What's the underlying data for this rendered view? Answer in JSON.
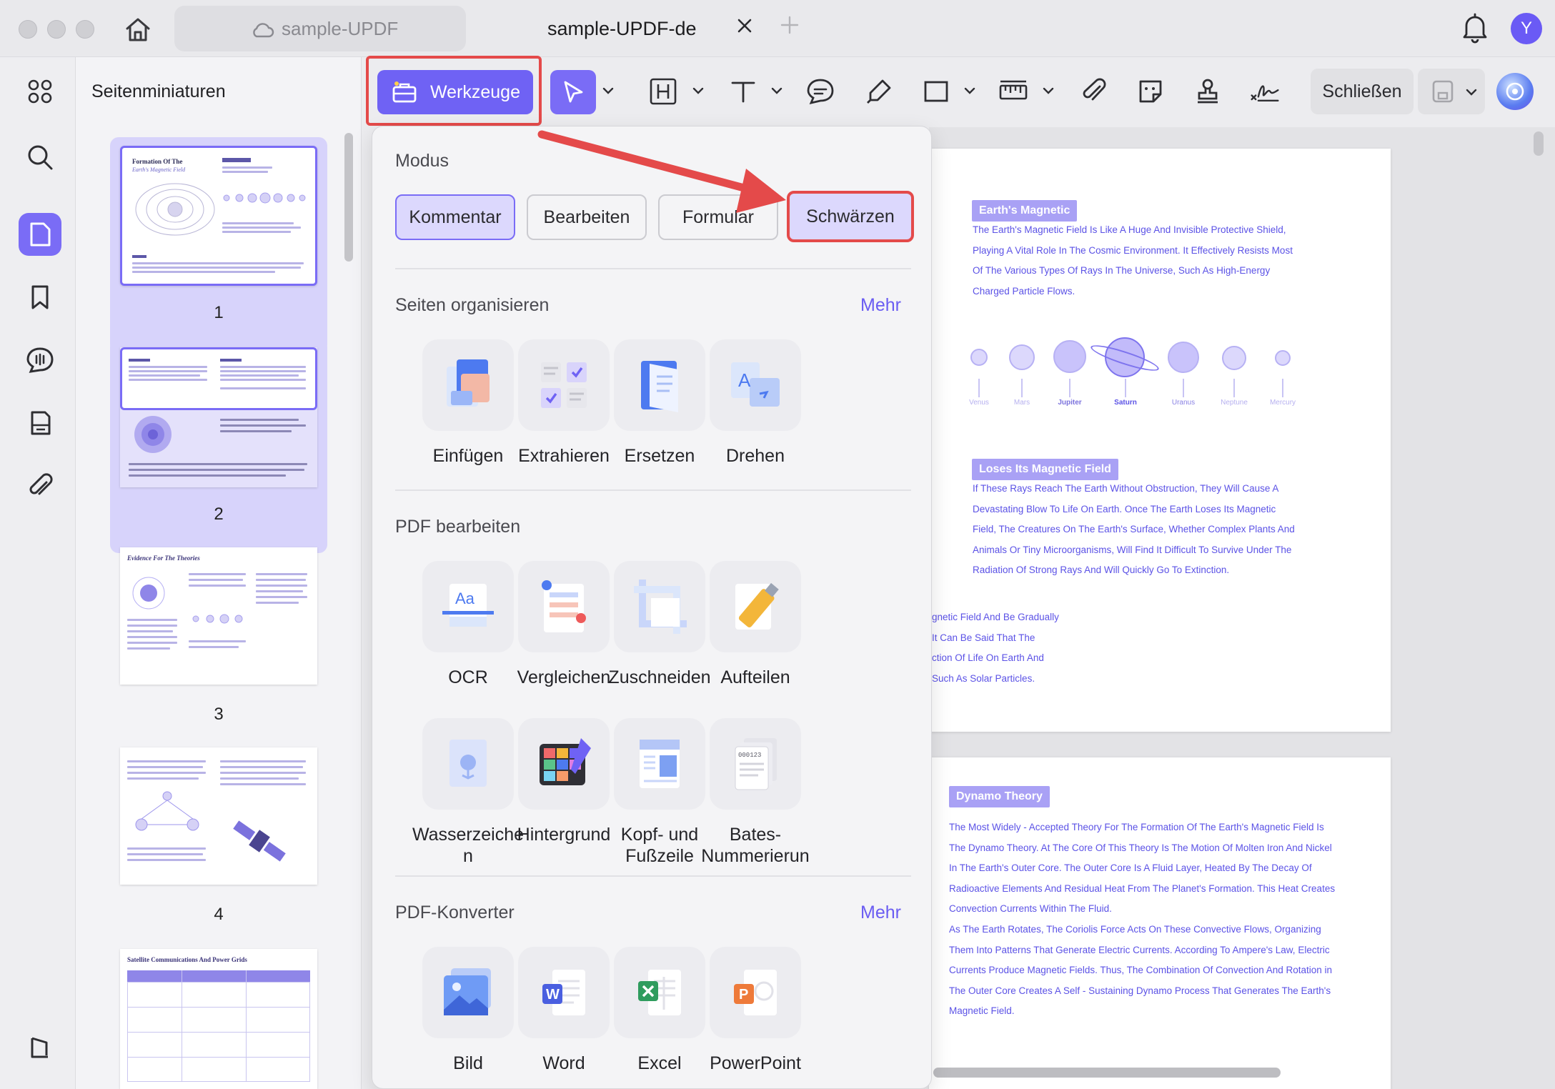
{
  "tabs": {
    "inactive_label": "sample-UPDF",
    "active_label": "sample-UPDF-de"
  },
  "user": {
    "initial": "Y"
  },
  "thumbnails": {
    "title": "Seitenminiaturen",
    "pages": [
      "1",
      "2",
      "3",
      "4"
    ],
    "page1_title_a": "Formation Of The",
    "page1_title_b": "Earth's Magnetic Field",
    "page3_title": "Evidence For The Theories",
    "page5_title": "Satellite Communications And Power Grids"
  },
  "toolbar": {
    "tools_label": "Werkzeuge",
    "close_label": "Schließen"
  },
  "popup": {
    "mode_title": "Modus",
    "modes": [
      "Kommentar",
      "Bearbeiten",
      "Formular",
      "Schwärzen"
    ],
    "organize_title": "Seiten organisieren",
    "organize_more": "Mehr",
    "organize_items": [
      "Einfügen",
      "Extrahieren",
      "Ersetzen",
      "Drehen"
    ],
    "edit_title": "PDF bearbeiten",
    "edit_items": [
      "OCR",
      "Vergleichen",
      "Zuschneiden",
      "Aufteilen",
      "Wasserzeiche\nn",
      "Hintergrund",
      "Kopf- und\nFußzeile",
      "Bates-\nNummerierun"
    ],
    "converter_title": "PDF-Konverter",
    "converter_more": "Mehr",
    "converter_items": [
      "Bild",
      "Word",
      "Excel",
      "PowerPoint"
    ]
  },
  "document": {
    "page1": {
      "heading1": "Earth's Magnetic",
      "para1": [
        "The Earth's Magnetic Field Is Like A Huge And Invisible Protective Shield,",
        "Playing A Vital Role In The Cosmic Environment. It Effectively Resists Most",
        "Of The Various Types Of Rays In The Universe, Such As High-Energy",
        "Charged Particle Flows."
      ],
      "planets": [
        "Venus",
        "Mars",
        "Jupiter",
        "Saturn",
        "Uranus",
        "Neptune",
        "Mercury"
      ],
      "heading2": "Loses Its Magnetic Field",
      "para2": [
        "If These Rays Reach The Earth Without Obstruction, They Will Cause A",
        "Devastating Blow To Life On Earth. Once The Earth Loses Its Magnetic",
        "Field, The Creatures On The Earth's Surface, Whether Complex Plants And",
        "Animals Or Tiny Microorganisms, Will Find It Difficult To Survive Under The",
        "Radiation Of Strong Rays And Will Quickly Go To Extinction."
      ],
      "para3": [
        "gnetic Field And Be Gradually",
        "It Can Be Said That The",
        "ction Of Life On Earth And",
        " Such As Solar Particles."
      ]
    },
    "page2": {
      "heading": "Dynamo Theory",
      "para": [
        "The Most Widely - Accepted Theory For The Formation Of The Earth's Magnetic Field Is",
        "The Dynamo Theory. At The Core Of This Theory Is The Motion Of Molten Iron And Nickel",
        "In The Earth's Outer Core. The Outer Core Is A Fluid Layer, Heated By The Decay Of",
        "Radioactive Elements And Residual Heat From The Planet's Formation. This Heat Creates",
        "Convection Currents Within The Fluid.",
        "As The Earth Rotates, The Coriolis Force Acts On These Convective Flows, Organizing",
        "Them Into Patterns That Generate Electric Currents. According To Ampere's Law, Electric",
        "Currents Produce Magnetic Fields. Thus, The Combination Of Convection And Rotation in",
        "The Outer Core Creates A Self - Sustaining Dynamo Process That Generates The Earth's",
        "Magnetic Field."
      ]
    }
  },
  "colors": {
    "accent": "#6f62f4",
    "highlight_red": "#e44a4a",
    "doc_text": "#5b52e6",
    "doc_heading_bg": "#a9a1f5"
  }
}
